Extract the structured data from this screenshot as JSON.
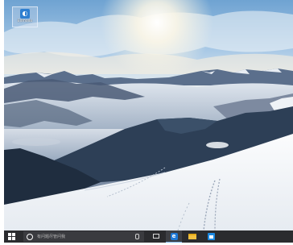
{
  "desktop": {
    "icons": [
      {
        "label": "Edmodo",
        "icon": "app-shortcut-icon"
      }
    ]
  },
  "taskbar": {
    "search_placeholder": "有问题尽管问我",
    "apps": [
      {
        "name": "Internet Explorer",
        "icon": "browser-icon",
        "glyph": "e",
        "active": true
      },
      {
        "name": "File Explorer",
        "icon": "folder-icon",
        "active": false
      },
      {
        "name": "Store",
        "icon": "store-icon",
        "active": false
      }
    ]
  },
  "colors": {
    "taskbar_bg": "#2a2b2e",
    "accent": "#1f79d6"
  }
}
